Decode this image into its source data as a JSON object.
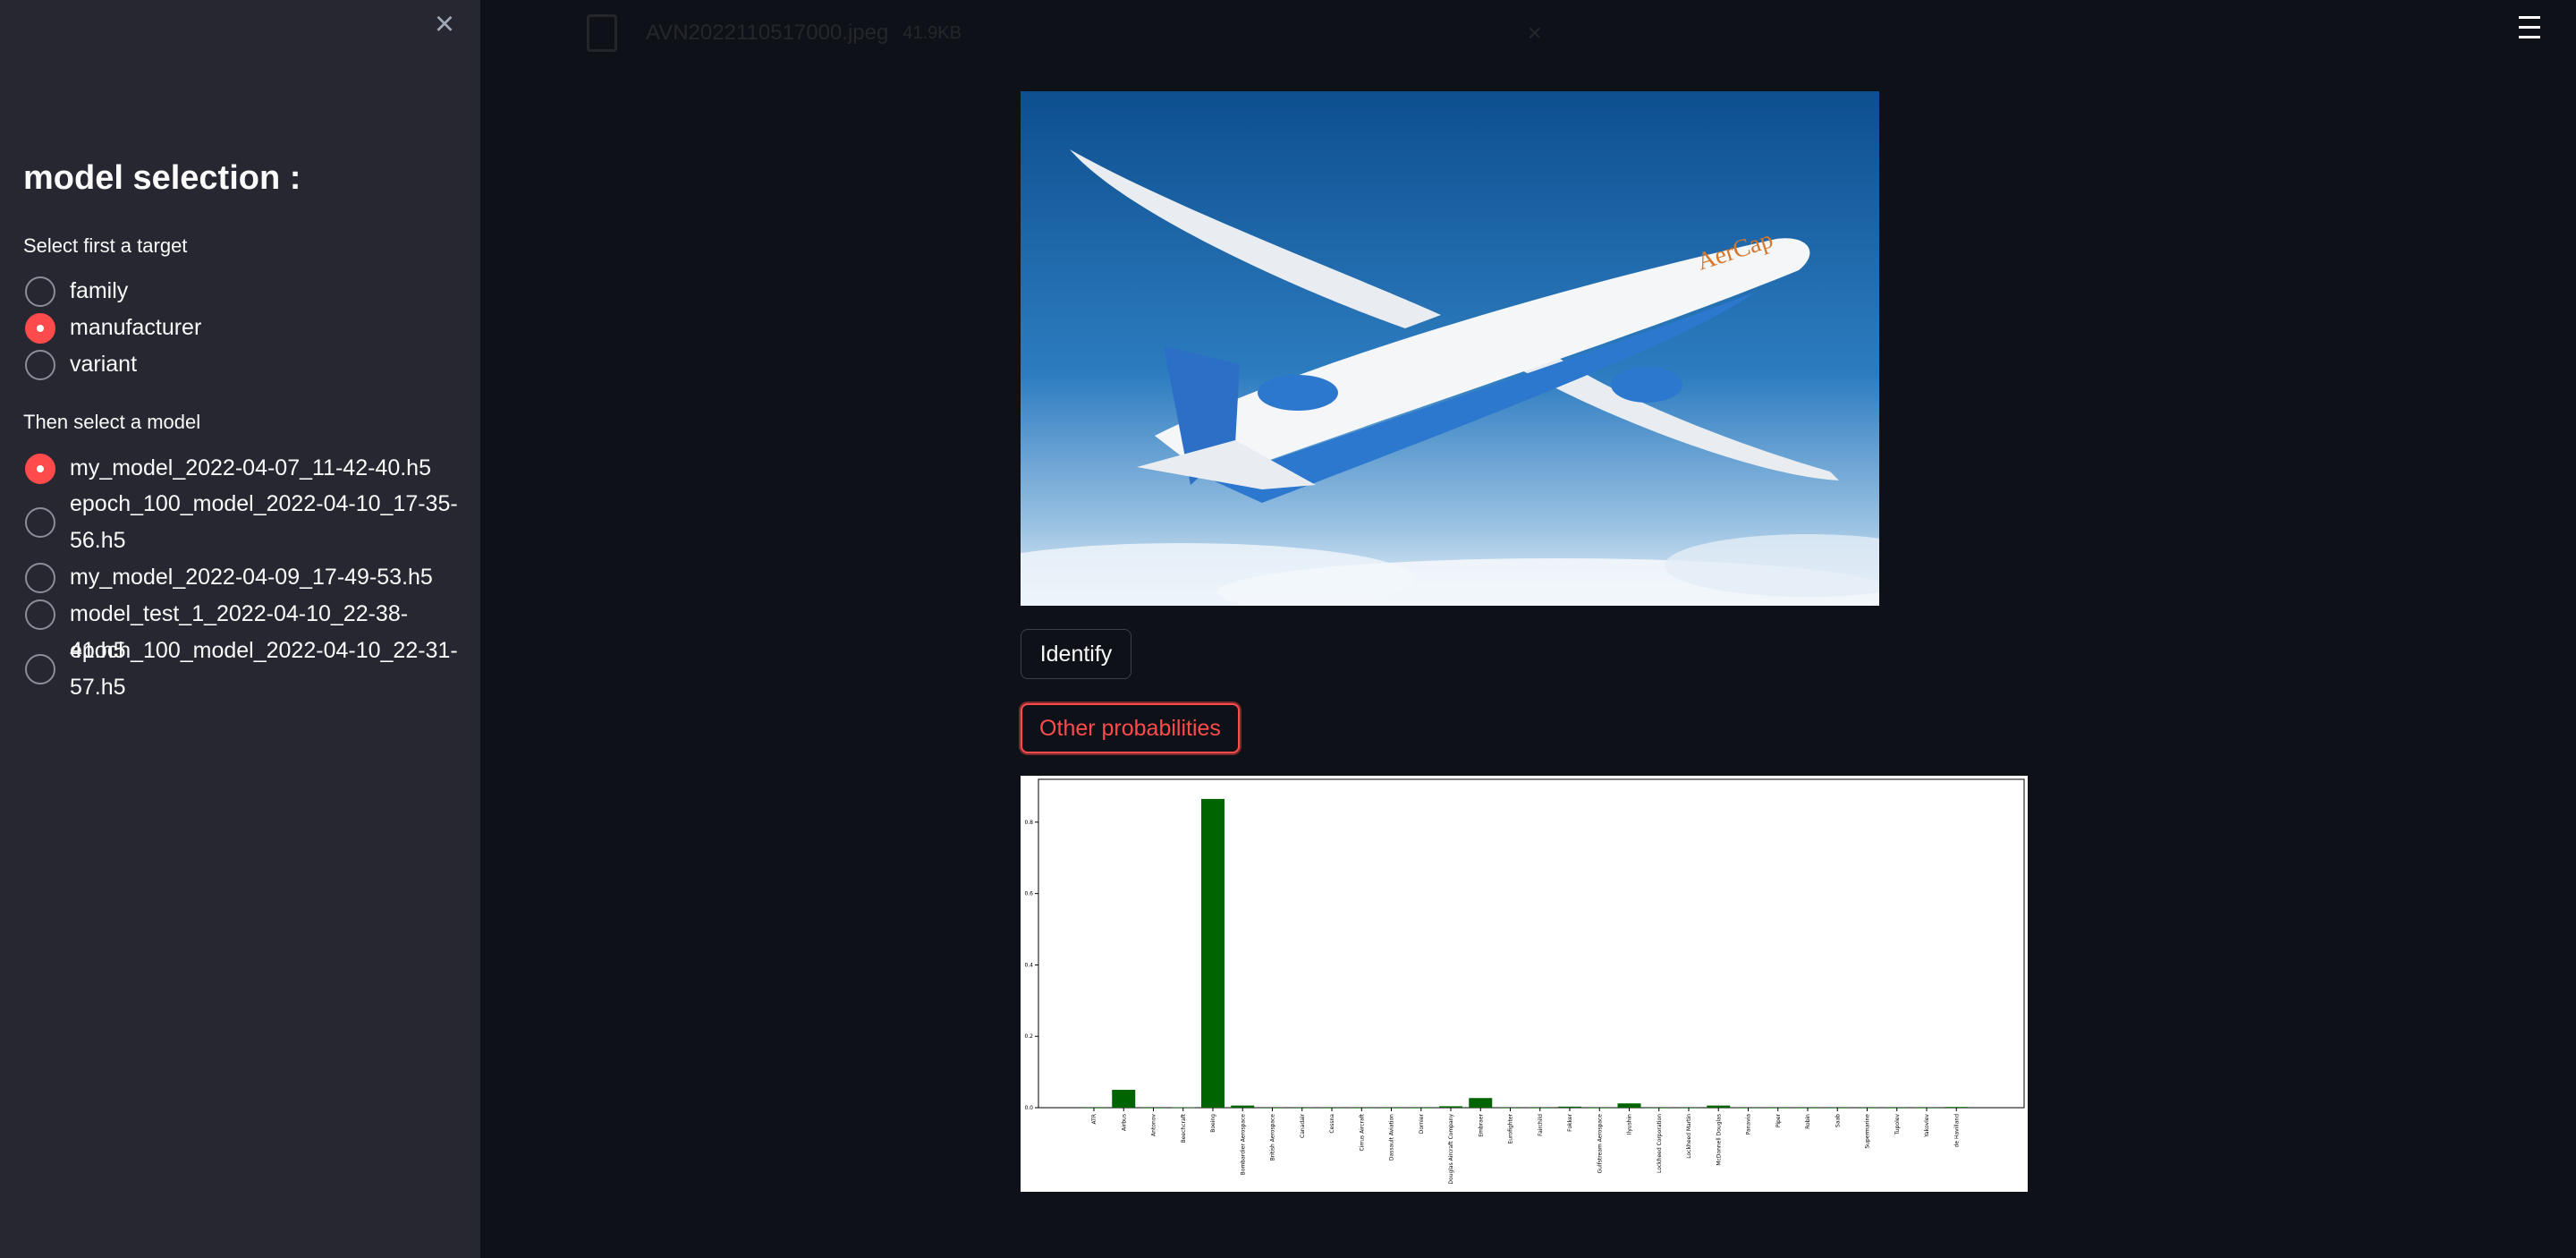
{
  "sidebar": {
    "close_icon": "×",
    "title": "model selection :",
    "target_label": "Select first a target",
    "targets": [
      {
        "label": "family",
        "checked": false
      },
      {
        "label": "manufacturer",
        "checked": true
      },
      {
        "label": "variant",
        "checked": false
      }
    ],
    "model_label": "Then select a model",
    "models": [
      {
        "label": "my_model_2022-04-07_11-42-40.h5",
        "checked": true
      },
      {
        "label": "epoch_100_model_2022-04-10_17-35-56.h5",
        "checked": false
      },
      {
        "label": "my_model_2022-04-09_17-49-53.h5",
        "checked": false
      },
      {
        "label": "model_test_1_2022-04-10_22-38-41.h5",
        "checked": false
      },
      {
        "label": "epoch_100_model_2022-04-10_22-31-57.h5",
        "checked": false
      }
    ]
  },
  "main": {
    "uploaded_file": {
      "name": "AVN2022110517000.jpeg",
      "size": "41.9KB",
      "remove_icon": "×"
    },
    "identify_label": "Identify",
    "other_probabilities_label": "Other probabilities"
  },
  "colors": {
    "accent": "#ff4b4b",
    "bar": "#006400",
    "sidebar_bg": "#262730",
    "main_bg": "#0e1117"
  },
  "chart_data": {
    "type": "bar",
    "title": "",
    "xlabel": "",
    "ylabel": "",
    "ylim": [
      0,
      0.92
    ],
    "yticks": [
      "0.0",
      "0.2",
      "0.4",
      "0.6",
      "0.8"
    ],
    "categories": [
      "ATR",
      "Airbus",
      "Antonov",
      "Beechcraft",
      "Boeing",
      "Bombardier Aerospace",
      "British Aerospace",
      "Canadair",
      "Cessna",
      "Cirrus Aircraft",
      "Dassault Aviation",
      "Dornier",
      "Douglas Aircraft Company",
      "Embraer",
      "Eurofighter",
      "Fairchild",
      "Fokker",
      "Gulfstream Aerospace",
      "Ilyushin",
      "Lockheed Corporation",
      "Lockheed Martin",
      "McDonnell Douglas",
      "Panavia",
      "Piper",
      "Robin",
      "Saab",
      "Supermarine",
      "Tupolev",
      "Yakovlev",
      "de Havilland"
    ],
    "values": [
      0.0,
      0.05,
      0.0,
      0.001,
      0.865,
      0.006,
      0.0,
      0.0,
      0.0,
      0.0,
      0.0,
      0.0,
      0.004,
      0.027,
      0.0,
      0.0,
      0.003,
      0.0,
      0.012,
      0.0,
      0.0,
      0.006,
      0.0,
      0.0,
      0.0,
      0.0,
      0.0,
      0.0,
      0.0,
      0.002
    ]
  }
}
